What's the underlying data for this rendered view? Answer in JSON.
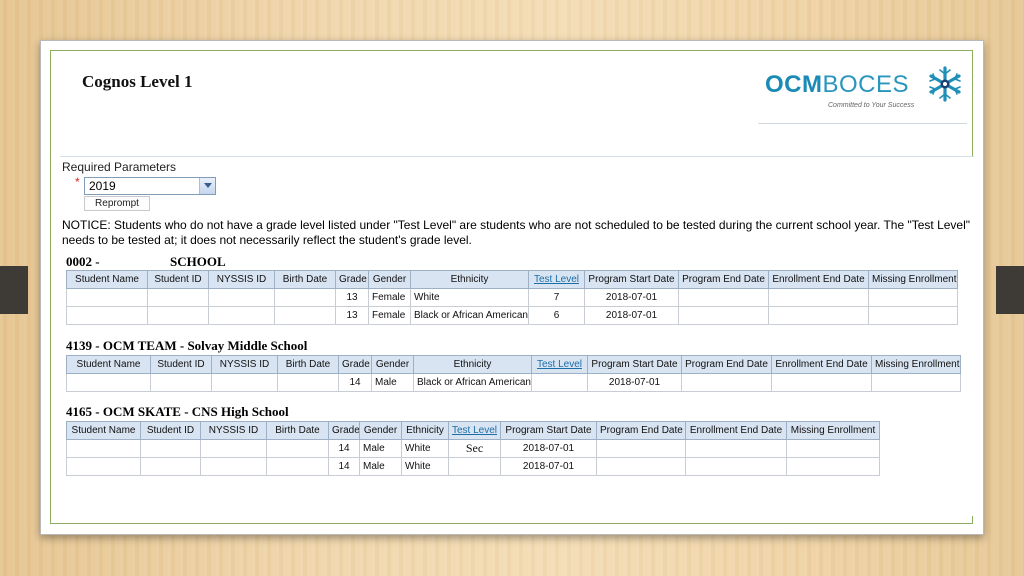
{
  "slide": {
    "title": "Cognos Level 1"
  },
  "logo": {
    "brand_bold": "OCM",
    "brand_light": "BOCES",
    "tagline": "Committed to Your Success",
    "star": "snowflake-star-icon"
  },
  "params": {
    "label": "Required Parameters",
    "required_marker": "*",
    "year_value": "2019",
    "reprompt_label": "Reprompt"
  },
  "notice": "NOTICE: Students who do not have a grade level listed under \"Test Level\" are students who are not scheduled to be tested during the current school year. The \"Test Level\" needs to be tested at; it does not necessarily reflect the student's grade level.",
  "sections": [
    {
      "code": "0002 -",
      "name": "SCHOOL",
      "columns": [
        "Student Name",
        "Student ID",
        "NYSSIS ID",
        "Birth Date",
        "Grade",
        "Gender",
        "Ethnicity",
        "Test Level",
        "Program Start Date",
        "Program End Date",
        "Enrollment End Date",
        "Missing Enrollment"
      ],
      "rows": [
        [
          "",
          "",
          "",
          "",
          "13",
          "Female",
          "White",
          "7",
          "2018-07-01",
          "",
          "",
          ""
        ],
        [
          "",
          "",
          "",
          "",
          "13",
          "Female",
          "Black or African American",
          "6",
          "2018-07-01",
          "",
          "",
          ""
        ]
      ]
    },
    {
      "title": "4139 - OCM TEAM - Solvay Middle School",
      "columns": [
        "Student Name",
        "Student ID",
        "NYSSIS ID",
        "Birth Date",
        "Grade",
        "Gender",
        "Ethnicity",
        "Test Level",
        "Program Start Date",
        "Program End Date",
        "Enrollment End Date",
        "Missing Enrollment"
      ],
      "rows": [
        [
          "",
          "",
          "",
          "",
          "14",
          "Male",
          "Black or African American",
          "",
          "2018-07-01",
          "",
          "",
          ""
        ]
      ]
    },
    {
      "title": "4165 - OCM SKATE - CNS High School",
      "columns": [
        "Student Name",
        "Student ID",
        "NYSSIS ID",
        "Birth Date",
        "Grade",
        "Gender",
        "Ethnicity",
        "Test Level",
        "Program Start Date",
        "Program End Date",
        "Enrollment End Date",
        "Missing Enrollment"
      ],
      "rows": [
        [
          "",
          "",
          "",
          "",
          "14",
          "Male",
          "White",
          "Sec",
          "2018-07-01",
          "",
          "",
          ""
        ],
        [
          "",
          "",
          "",
          "",
          "14",
          "Male",
          "White",
          "",
          "2018-07-01",
          "",
          "",
          ""
        ]
      ]
    }
  ]
}
